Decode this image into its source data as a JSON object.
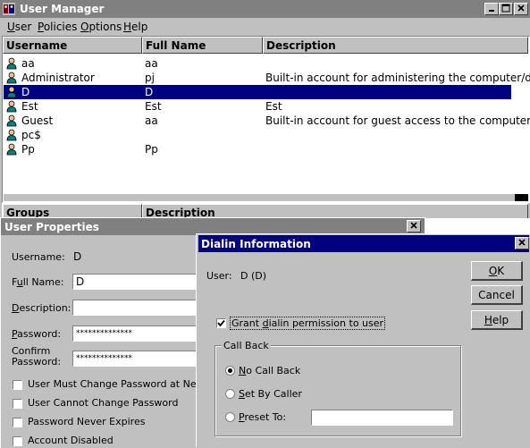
{
  "main": {
    "title": "User Manager",
    "menu": [
      "User",
      "Policies",
      "Options",
      "Help"
    ],
    "columns": [
      "Username",
      "Full Name",
      "Description"
    ],
    "users": [
      {
        "username": "aa",
        "fullname": "aa",
        "description": ""
      },
      {
        "username": "Administrator",
        "fullname": "pj",
        "description": "Built-in account for administering the computer/dom"
      },
      {
        "username": "D",
        "fullname": "D",
        "description": ""
      },
      {
        "username": "Est",
        "fullname": "Est",
        "description": "Est"
      },
      {
        "username": "Guest",
        "fullname": "aa",
        "description": "Built-in account for guest access to the computer/d"
      },
      {
        "username": "pc$",
        "fullname": "",
        "description": ""
      },
      {
        "username": "Pp",
        "fullname": "Pp",
        "description": ""
      }
    ],
    "selected_index": 2,
    "groups_columns": [
      "Groups",
      "Description"
    ]
  },
  "props": {
    "title": "User Properties",
    "username_label": "Username:",
    "username_value": "D",
    "fullname_label": "Full Name:",
    "fullname_value": "D",
    "description_label": "Description:",
    "description_value": "",
    "password_label": "Password:",
    "password_value": "**************",
    "confirm_label_1": "Confirm",
    "confirm_label_2": "Password:",
    "confirm_value": "**************",
    "checkboxes": [
      "User Must Change Password at Next Lo",
      "User Cannot Change Password",
      "Password Never Expires",
      "Account Disabled"
    ]
  },
  "dialin": {
    "title": "Dialin Information",
    "user_label": "User:",
    "user_value": "D  (D)",
    "grant_label": "Grant dialin permission to user",
    "grant_checked": true,
    "callback_group": "Call Back",
    "radios": [
      "No Call Back",
      "Set By Caller",
      "Preset To:"
    ],
    "radio_selected": 0,
    "preset_value": "",
    "ok_label": "OK",
    "cancel_label": "Cancel",
    "help_label": "Help"
  },
  "icons": {
    "app": "user-manager-icon",
    "user": "user-icon",
    "minimize": "minimize-icon",
    "maximize": "maximize-icon",
    "close": "close-icon"
  }
}
